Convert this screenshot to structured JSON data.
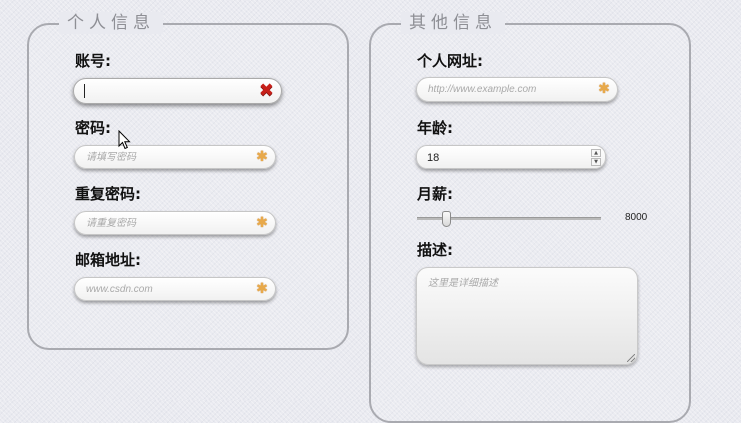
{
  "personal": {
    "legend": "个人信息",
    "account": {
      "label": "账号:",
      "value": ""
    },
    "password": {
      "label": "密码:",
      "placeholder": "请填写密码"
    },
    "confirm_password": {
      "label": "重复密码:",
      "placeholder": "请重复密码"
    },
    "email": {
      "label": "邮箱地址:",
      "placeholder": "www.csdn.com"
    }
  },
  "other": {
    "legend": "其他信息",
    "website": {
      "label": "个人网址:",
      "placeholder": "http://www.example.com"
    },
    "age": {
      "label": "年龄:",
      "value": "18"
    },
    "salary": {
      "label": "月薪:",
      "value": "8000",
      "min": 0,
      "max": 50000,
      "fraction": 0.16
    },
    "description": {
      "label": "描述:",
      "placeholder": "这里是详细描述"
    }
  },
  "icons": {
    "required": "asterisk-icon",
    "invalid": "x-icon",
    "spinner": "spinner-arrows-icon",
    "cursor": "mouse-pointer-icon"
  },
  "colors": {
    "invalid": "#c7201a",
    "required": "#e8a94a",
    "border": "#a9aab0"
  }
}
